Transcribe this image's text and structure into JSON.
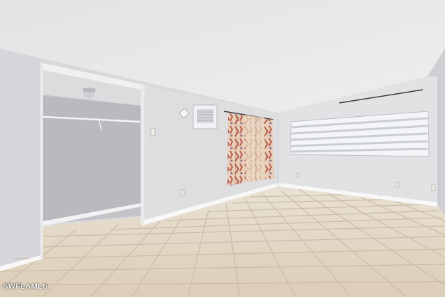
{
  "photo": {
    "watermark_text": "SWFLAMLS",
    "colors": {
      "ceiling": "#e9e9ea",
      "wall": "#dcdcdf",
      "wall_shadow": "#c6c6ca",
      "closet_interior": "#bdbdc2",
      "floor_tile": "#e4d8c6",
      "grout": "#c9bba6",
      "baseboard": "#f7f7f7",
      "curtain_base": "#e6c9b0",
      "curtain_pattern": "#b5574e",
      "blind_light": "#f5f6f8",
      "blind_dark": "#c9ccd4"
    }
  }
}
